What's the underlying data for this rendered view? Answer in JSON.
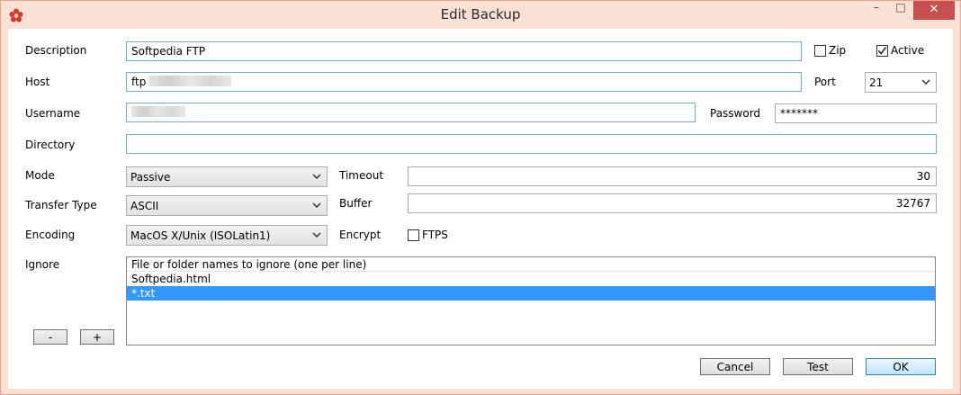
{
  "window": {
    "title": "Edit Backup",
    "controls": {
      "minimize": "–",
      "maximize": "□",
      "close": "✕"
    },
    "colors": {
      "frame": "#fbe1d4",
      "close": "#c75050",
      "accent": "#3399ff"
    }
  },
  "form": {
    "description": {
      "label": "Description",
      "value": "Softpedia FTP"
    },
    "zip": {
      "label": "Zip",
      "checked": false
    },
    "active": {
      "label": "Active",
      "checked": true
    },
    "host": {
      "label": "Host",
      "value": "ftp"
    },
    "port": {
      "label": "Port",
      "value": "21"
    },
    "username": {
      "label": "Username",
      "value": ""
    },
    "password": {
      "label": "Password",
      "value": "*******"
    },
    "directory": {
      "label": "Directory",
      "value": ""
    },
    "mode": {
      "label": "Mode",
      "value": "Passive"
    },
    "timeout": {
      "label": "Timeout",
      "value": "30"
    },
    "transfer_type": {
      "label": "Transfer Type",
      "value": "ASCII"
    },
    "buffer": {
      "label": "Buffer",
      "value": "32767"
    },
    "encoding": {
      "label": "Encoding",
      "value": "MacOS X/Unix (ISOLatin1)"
    },
    "encrypt": {
      "label": "Encrypt"
    },
    "ftps": {
      "label": "FTPS",
      "checked": false
    },
    "ignore": {
      "label": "Ignore",
      "header": "File or folder names to ignore (one per line)",
      "items": [
        "Softpedia.html",
        "*.txt"
      ],
      "selected_index": 1
    },
    "remove_label": "-",
    "add_label": "+"
  },
  "buttons": {
    "cancel": "Cancel",
    "test": "Test",
    "ok": "OK"
  },
  "icons": {
    "app": "flower-icon",
    "dropdown": "chevron-down-icon",
    "checkbox": "check-icon"
  }
}
